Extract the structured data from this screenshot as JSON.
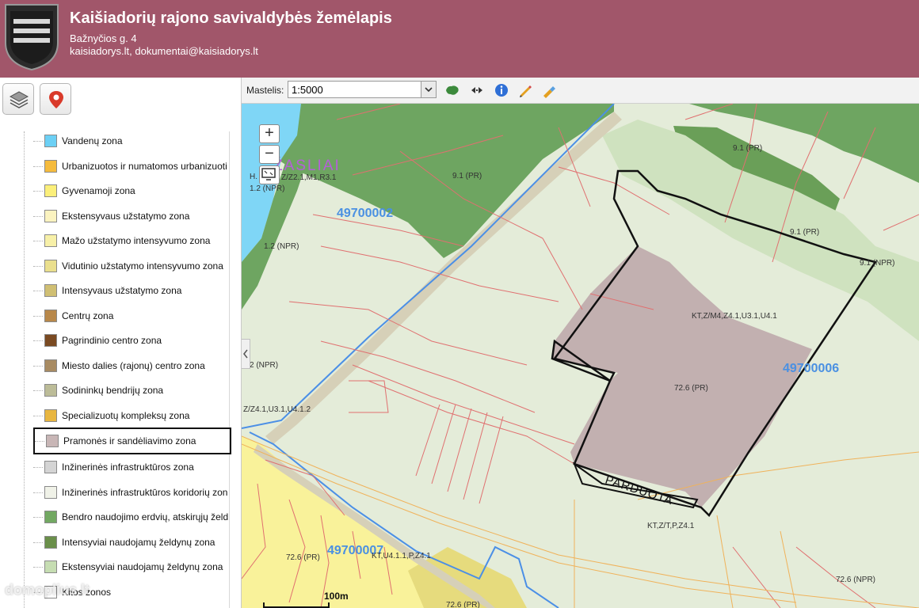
{
  "header": {
    "title": "Kaišiadorių rajono savivaldybės žemėlapis",
    "address": "Bažnyčios g. 4",
    "contacts": "kaisiadorys.lt, dokumentai@kaisiadorys.lt"
  },
  "toolbar": {
    "scale_label": "Mastelis:",
    "scale_value": "1:5000",
    "scale_options": [
      "1:5000"
    ]
  },
  "colors": {
    "header_bg": "#a1566a",
    "sidebar_bg": "#ffffff",
    "map_light": "#e4ecd9",
    "map_green_dark": "#6ea561",
    "map_green_light": "#cfe2bf",
    "water": "#7fd6f6",
    "industrial": "#c2b0b0",
    "residential": "#f9f29a",
    "parcel_line": "#e07070",
    "road_blue": "#4b8fe6",
    "parcel_label_blue": "#4a90e2",
    "place_label_purple": "#b55fd8"
  },
  "legend": [
    {
      "label": "Vandenų zona",
      "color": "#6cd0f5"
    },
    {
      "label": "Urbanizuotos ir numatomos urbanizuoti",
      "color": "#f5bb3d"
    },
    {
      "label": "Gyvenamoji zona",
      "color": "#fbef7a"
    },
    {
      "label": "Ekstensyvaus užstatymo zona",
      "color": "#fbf3c0"
    },
    {
      "label": "Mažo užstatymo intensyvumo zona",
      "color": "#f7f0a8"
    },
    {
      "label": "Vidutinio užstatymo intensyvumo zona",
      "color": "#eadf8d"
    },
    {
      "label": "Intensyvaus užstatymo zona",
      "color": "#d0bf73"
    },
    {
      "label": "Centrų zona",
      "color": "#b8884a"
    },
    {
      "label": "Pagrindinio centro zona",
      "color": "#7a4a22"
    },
    {
      "label": "Miesto dalies (rajonų) centro zona",
      "color": "#a88b62"
    },
    {
      "label": "Sodininkų bendrijų zona",
      "color": "#bcbc98"
    },
    {
      "label": "Specializuotų kompleksų zona",
      "color": "#e8b640"
    },
    {
      "label": "Pramonės ir sandėliavimo zona",
      "color": "#c8b6b6",
      "highlighted": true
    },
    {
      "label": "Inžinerinės infrastruktūros zona",
      "color": "#d4d4d4"
    },
    {
      "label": "Inžinerinės infrastruktūros koridorių zon",
      "color": "#f0f2e8"
    },
    {
      "label": "Bendro naudojimo erdvių, atskirųjų želd",
      "color": "#72a862"
    },
    {
      "label": "Intensyviai naudojamų želdynų zona",
      "color": "#6a8f4a"
    },
    {
      "label": "Ekstensyviai naudojamų želdynų zona",
      "color": "#c6ddb2"
    },
    {
      "label": "Kitos zonos",
      "color": "#ffffff"
    }
  ],
  "map": {
    "labels": {
      "place": "ŽASLIAI",
      "parcel_1": "49700002",
      "parcel_2": "49700006",
      "parcel_3": "49700007",
      "sold": "PARDUOTA",
      "zone_h": "H.",
      "zone_zz": "Z/Z2.1,M1,R3.1",
      "z_npr_1": "1.2 (NPR)",
      "z_91pr_1": "9.1 (PR)",
      "z_91pr_2": "9.1 (PR)",
      "z_91pr_3": "9.1 (PR)",
      "z_91npr": "9.1 (NPR)",
      "z_12npr_2": "1.2 (NPR)",
      "kt_code": "KT,Z/M4,Z4.1,U3.1,U4.1",
      "z_726pr": "72.6 (PR)",
      "z_2npr": "2 (NPR)",
      "zz_code": "Z/Z4.1,U3.1,U4.1.2",
      "kt_zt": "KT,Z/T,P,Z4.1",
      "kt_u4": "KT,U4.1.1,P,Z4.1",
      "z_726pr_2": "72.6 (PR)",
      "z_726pr_3": "72.6 (PR)",
      "z_726npr": "72.6 (NPR)",
      "scalebar": "100m",
      "watermark": "domoplius.lt"
    }
  }
}
